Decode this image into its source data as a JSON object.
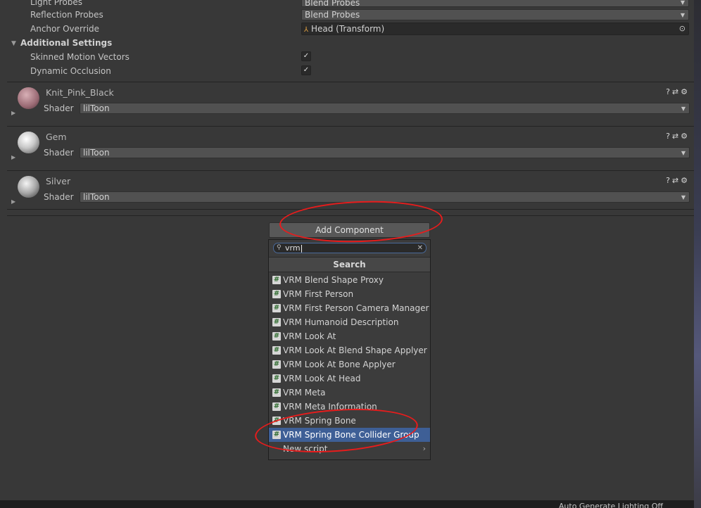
{
  "inspector": {
    "rows": [
      {
        "label": "Light Probes",
        "value": "Blend Probes"
      },
      {
        "label": "Reflection Probes",
        "value": "Blend Probes"
      },
      {
        "label": "Anchor Override",
        "value": "Head (Transform)"
      }
    ],
    "additional_settings": {
      "title": "Additional Settings",
      "skinned_motion_vectors": {
        "label": "Skinned Motion Vectors",
        "checked": true
      },
      "dynamic_occlusion": {
        "label": "Dynamic Occlusion",
        "checked": true
      }
    },
    "materials": [
      {
        "name": "Knit_Pink_Black",
        "shader_label": "Shader",
        "shader": "lilToon"
      },
      {
        "name": "Gem",
        "shader_label": "Shader",
        "shader": "lilToon"
      },
      {
        "name": "Silver",
        "shader_label": "Shader",
        "shader": "lilToon"
      }
    ]
  },
  "add_component": {
    "button_label": "Add Component",
    "search_value": "vrm",
    "search_header": "Search",
    "results": [
      "VRM Blend Shape Proxy",
      "VRM First Person",
      "VRM First Person Camera Manager",
      "VRM Humanoid Description",
      "VRM Look At",
      "VRM Look At Blend Shape Applyer",
      "VRM Look At Bone Applyer",
      "VRM Look At Head",
      "VRM Meta",
      "VRM Meta Information",
      "VRM Spring Bone",
      "VRM Spring Bone Collider Group"
    ],
    "selected_index": 11,
    "new_script_label": "New script"
  },
  "status_bar": {
    "text": "Auto Generate Lighting Off"
  },
  "icons": {
    "script": "#",
    "check": "✓",
    "help": "?",
    "preset": "⇄",
    "settings": "⚙"
  },
  "colors": {
    "selection": "#3e5f96",
    "annotation": "#e81c1c",
    "background": "#383838"
  }
}
